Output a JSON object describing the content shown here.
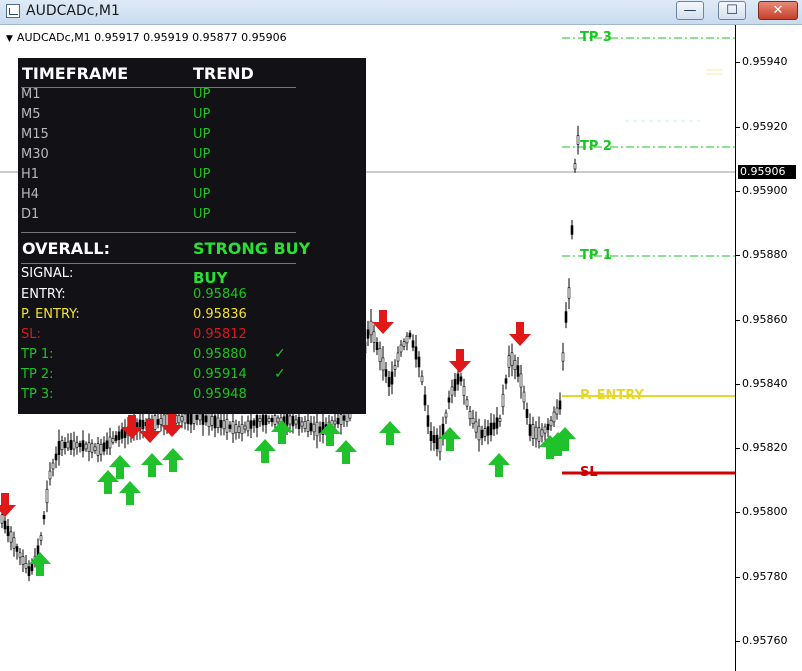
{
  "window": {
    "title": "AUDCADc,M1",
    "minimize": "—",
    "maximize": "☐",
    "close": "✕"
  },
  "chart": {
    "symbol_line": "AUDCADc,M1  0.95917 0.95919 0.95877 0.95906",
    "current_price": "0.95906",
    "price_labels": [
      "0.95940",
      "0.95920",
      "0.95900",
      "0.95880",
      "0.95860",
      "0.95840",
      "0.95820",
      "0.95800",
      "0.95780",
      "0.95760"
    ],
    "colors": {
      "up_arrow": "#1fc22a",
      "down_arrow": "#e01818",
      "tp_line": "#19c51e",
      "entry_line": "#e6d82a",
      "sl_line": "#d00000",
      "candle": "#000000"
    }
  },
  "levels": {
    "tp3": "TP 3",
    "tp2": "TP 2",
    "tp1": "TP 1",
    "p_entry": "P. ENTRY",
    "sl": "SL"
  },
  "panel": {
    "header_timeframe": "TIMEFRAME",
    "header_trend": "TREND",
    "rows": [
      {
        "tf": "M1",
        "trend": "UP"
      },
      {
        "tf": "M5",
        "trend": "UP"
      },
      {
        "tf": "M15",
        "trend": "UP"
      },
      {
        "tf": "M30",
        "trend": "UP"
      },
      {
        "tf": "H1",
        "trend": "UP"
      },
      {
        "tf": "H4",
        "trend": "UP"
      },
      {
        "tf": "D1",
        "trend": "UP"
      }
    ],
    "overall_label": "OVERALL:",
    "overall_value": "STRONG BUY",
    "signal_label": "SIGNAL:",
    "signal_value": "BUY",
    "entry_label": "ENTRY:",
    "entry_value": "0.95846",
    "p_entry_label": "P. ENTRY:",
    "p_entry_value": "0.95836",
    "sl_label": "SL:",
    "sl_value": "0.95812",
    "tp1_label": "TP 1:",
    "tp1_value": "0.95880",
    "tp2_label": "TP 2:",
    "tp2_value": "0.95914",
    "tp3_label": "TP 3:",
    "tp3_value": "0.95948",
    "check": "✓"
  }
}
